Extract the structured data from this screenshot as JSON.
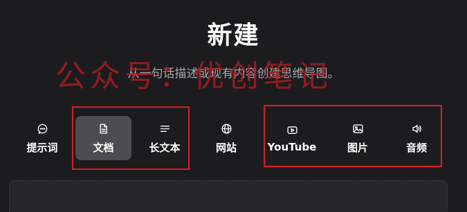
{
  "header": {
    "title": "新建",
    "subtitle": "从一句话描述或现有内容创建思维导图。"
  },
  "watermark": {
    "text": "公众号：优创笔记"
  },
  "tabs": [
    {
      "label": "提示词",
      "icon": "chat-bubble-icon",
      "active": false
    },
    {
      "label": "文档",
      "icon": "document-icon",
      "active": true
    },
    {
      "label": "长文本",
      "icon": "text-lines-icon",
      "active": false
    },
    {
      "label": "网站",
      "icon": "globe-icon",
      "active": false
    },
    {
      "label": "YouTube",
      "icon": "play-button-icon",
      "active": false
    },
    {
      "label": "图片",
      "icon": "image-icon",
      "active": false
    },
    {
      "label": "音频",
      "icon": "speaker-icon",
      "active": false
    }
  ],
  "colors": {
    "background": "#1c1c1f",
    "active_tab": "#4b4d52",
    "highlight_border": "#d81e24",
    "watermark": "#b21c20"
  }
}
